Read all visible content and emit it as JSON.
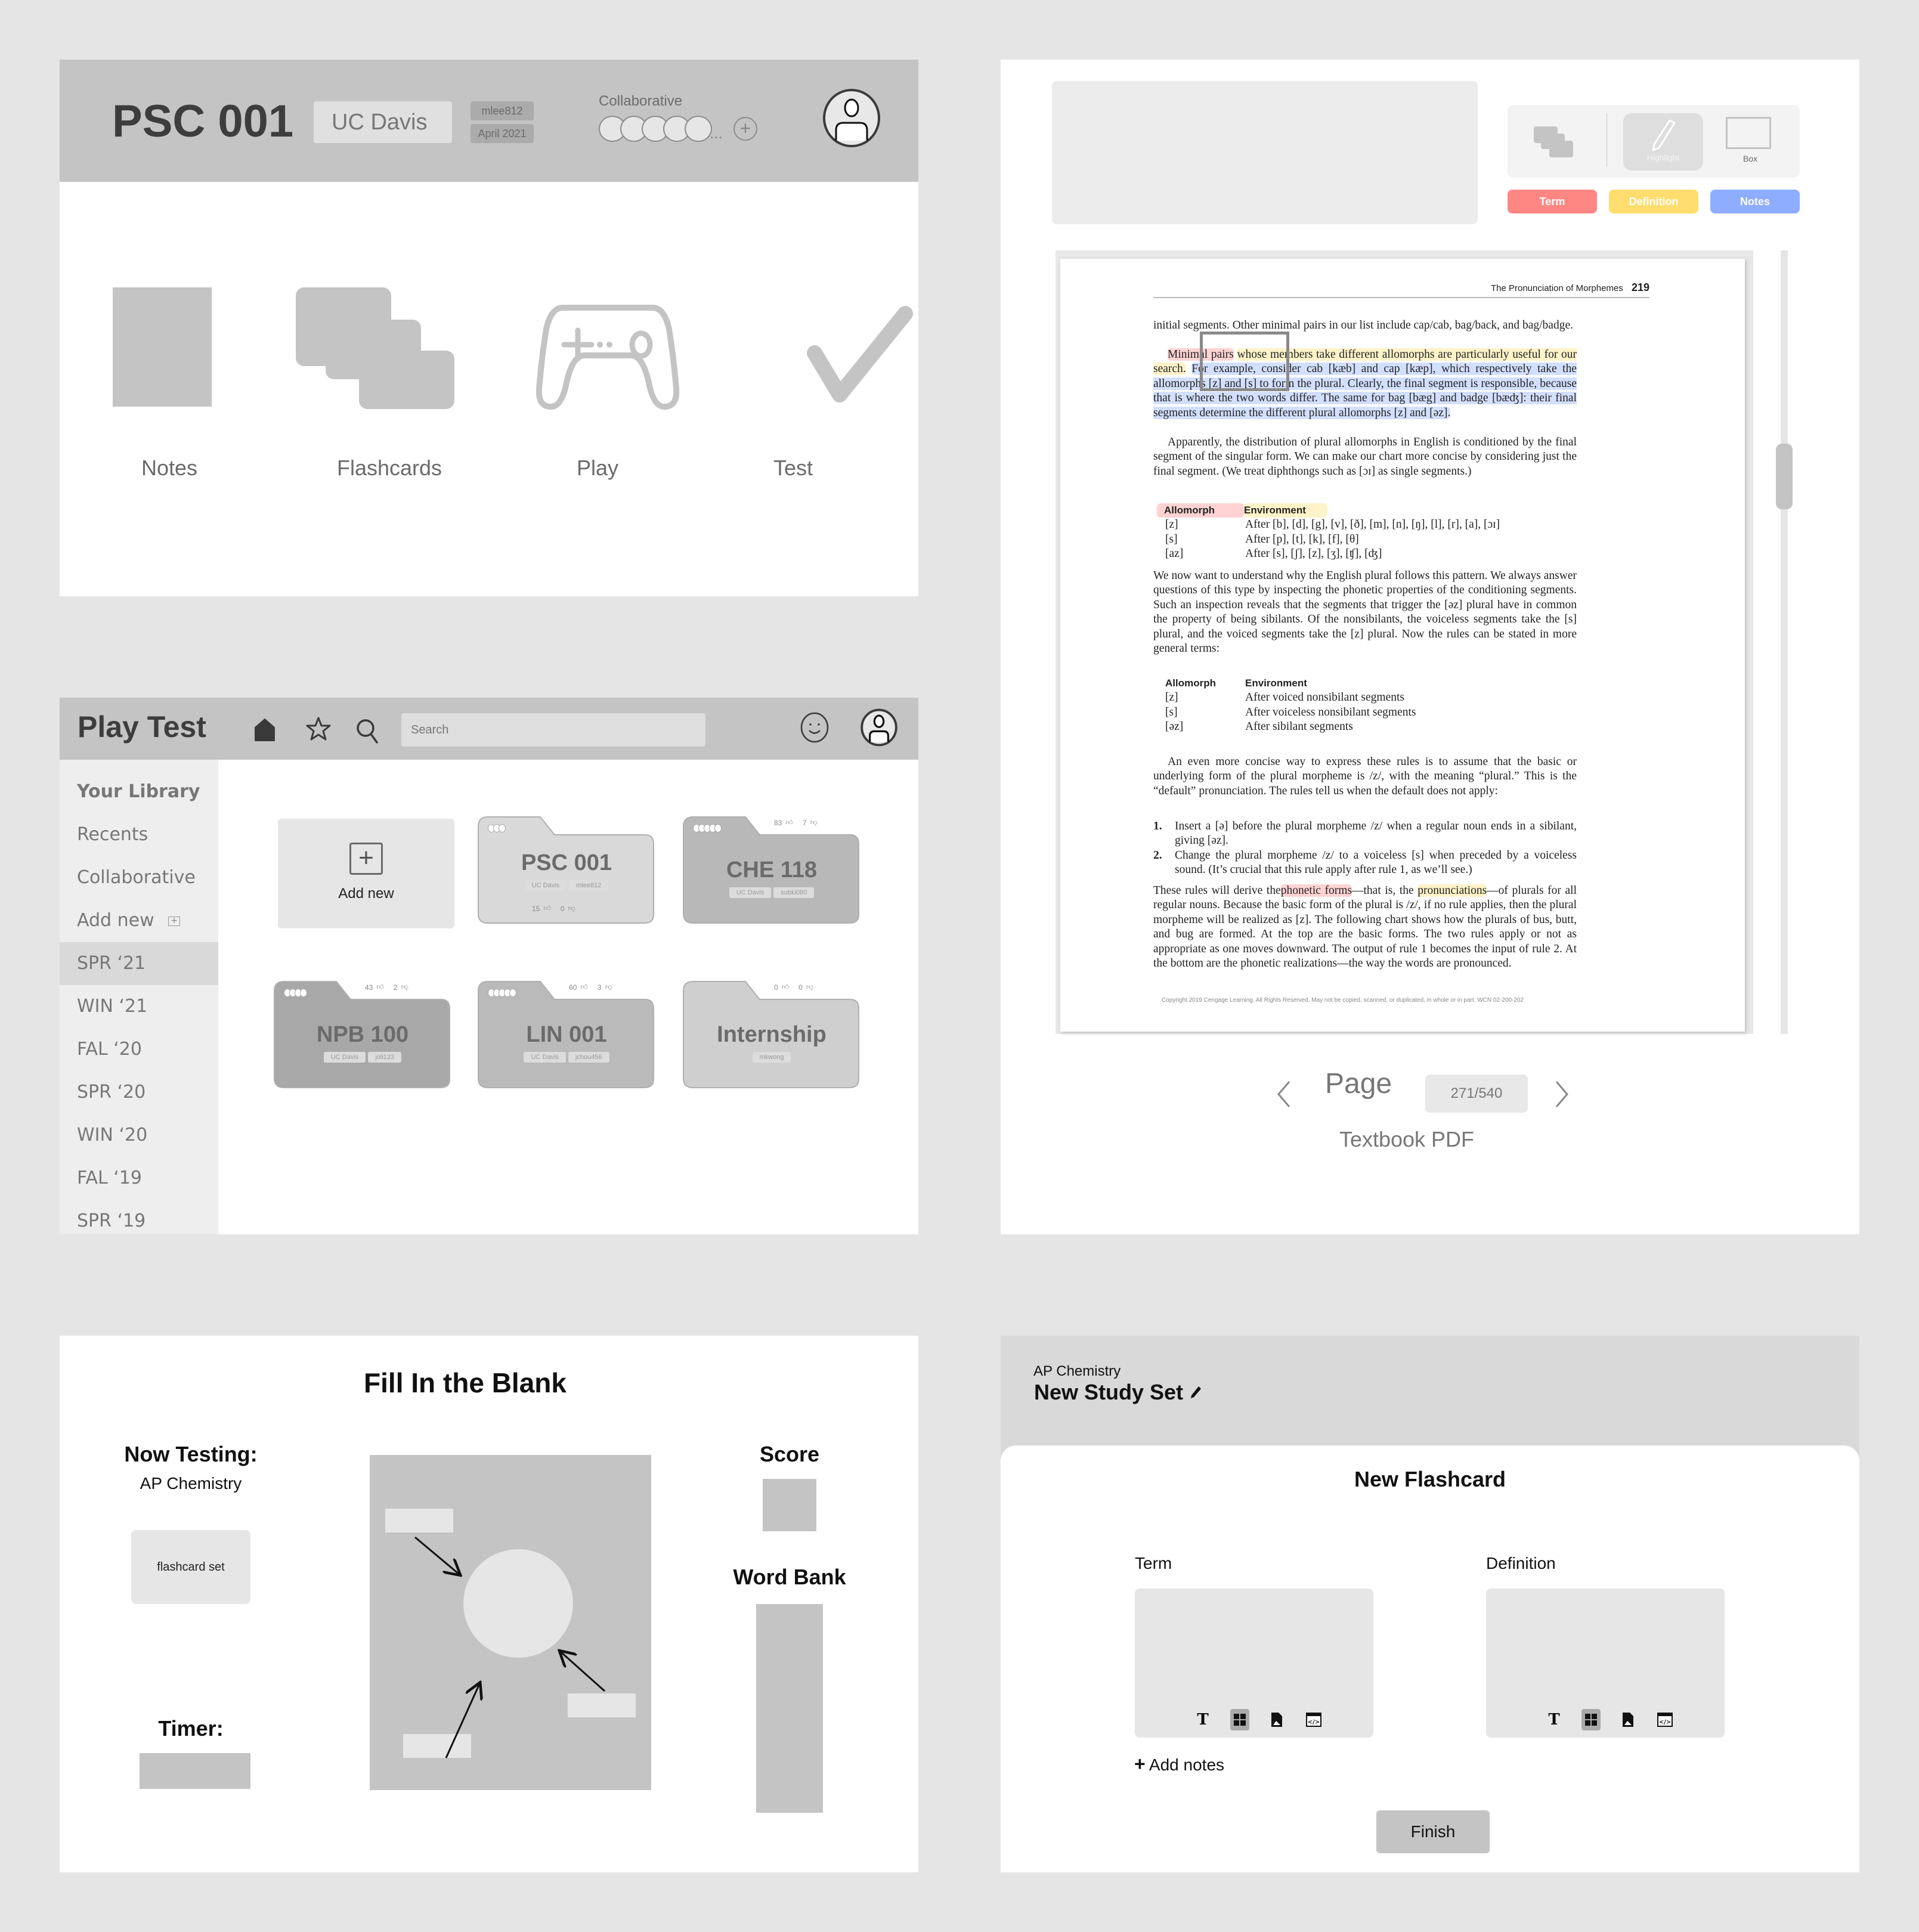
{
  "course_overview": {
    "title": "PSC 001",
    "school": "UC Davis",
    "owner": "mlee812",
    "term": "April 2021",
    "collaborative_label": "Collaborative",
    "collaborators_overflow": "...",
    "modes": [
      {
        "label": "Notes",
        "icon": "notes-icon"
      },
      {
        "label": "Flashcards",
        "icon": "flashcards-icon"
      },
      {
        "label": "Play",
        "icon": "gamepad-icon"
      },
      {
        "label": "Test",
        "icon": "checkmark-icon"
      }
    ]
  },
  "library": {
    "title": "Play Test",
    "search_placeholder": "Search",
    "sidebar": [
      {
        "label": "Your Library",
        "heading": true
      },
      {
        "label": "Recents"
      },
      {
        "label": "Collaborative"
      },
      {
        "label": "Add new",
        "icon": "plus-box-icon"
      },
      {
        "label": "SPR ‘21",
        "active": true
      },
      {
        "label": "WIN ‘21"
      },
      {
        "label": "FAL ‘20"
      },
      {
        "label": "SPR ‘20"
      },
      {
        "label": "WIN ‘20"
      },
      {
        "label": "FAL ‘19"
      },
      {
        "label": "SPR ‘19"
      }
    ],
    "add_new_label": "Add new",
    "folders": [
      {
        "title": "PSC 001",
        "tags": [
          "UC Davis",
          "mlee812"
        ],
        "likes": "15",
        "dislikes": "0",
        "collaborators": 3,
        "color": "#d9d9d9"
      },
      {
        "title": "CHE 118",
        "tags": [
          "UC Davis",
          "subki080"
        ],
        "likes": "83",
        "dislikes": "7",
        "collaborators": 5,
        "color": "#b8b8b8"
      },
      {
        "title": "NPB 100",
        "tags": [
          "UC Davis",
          "joli123"
        ],
        "likes": "43",
        "dislikes": "2",
        "collaborators": 4,
        "color": "#a8a8a8"
      },
      {
        "title": "LIN 001",
        "tags": [
          "UC Davis",
          "jchou456"
        ],
        "likes": "60",
        "dislikes": "3",
        "collaborators": 5,
        "color": "#bababa"
      },
      {
        "title": "Internship",
        "tags": [
          "mkwong"
        ],
        "likes": "0",
        "dislikes": "0",
        "collaborators": 0,
        "color": "#cfcfcf"
      }
    ]
  },
  "pdf_viewer": {
    "tools": {
      "highlight_label": "Highlight",
      "box_label": "Box"
    },
    "categories": [
      {
        "label": "Term",
        "color": "#ff8783"
      },
      {
        "label": "Definition",
        "color": "#ffdd6e"
      },
      {
        "label": "Notes",
        "color": "#8eadff"
      }
    ],
    "page_header": "The Pronunciation of Morphemes",
    "page_number": "219",
    "para1": "initial segments. Other minimal pairs in our list include cap/cab, bag/back, and bag/badge.",
    "para2_term": "Minimal pairs",
    "para2_def": "whose members take different allomorphs are particularly useful for our search.",
    "para2_note": "For example, consider cab [kæb] and cap [kæp], which respectively take the allomorphs [z] and [s] to form the plural. Clearly, the final segment is responsible, because that is where the two words differ. The same for bag [bæg] and badge [bæʤ]: their final segments determine the different plural allomorphs [z] and [əz].",
    "para3": "Apparently, the distribution of plural allomorphs in English is conditioned by the final segment of the singular form. We can make our chart more concise by considering just the final segment. (We treat diphthongs such as [ɔɪ] as single segments.)",
    "table1": {
      "headers": [
        "Allomorph",
        "Environment"
      ],
      "rows": [
        [
          "[z]",
          "After [b], [d], [g], [v], [ð], [m], [n], [ŋ], [l], [r], [a], [ɔɪ]"
        ],
        [
          "[s]",
          "After [p], [t], [k], [f], [θ]"
        ],
        [
          "[az]",
          "After [s], [ʃ], [z], [ʒ], [ʧ], [ʤ]"
        ]
      ]
    },
    "para4": "We now want to understand why the English plural follows this pattern. We always answer questions of this type by inspecting the phonetic properties of the conditioning segments. Such an inspection reveals that the segments that trigger the [əz] plural have in common the property of being sibilants. Of the nonsibilants, the voiceless segments take the [s] plural, and the voiced segments take the [z] plural. Now the rules can be stated in more general terms:",
    "table2": {
      "headers": [
        "Allomorph",
        "Environment"
      ],
      "rows": [
        [
          "[z]",
          "After voiced nonsibilant segments"
        ],
        [
          "[s]",
          "After voiceless nonsibilant segments"
        ],
        [
          "[əz]",
          "After sibilant segments"
        ]
      ]
    },
    "para5": "An even more concise way to express these rules is to assume that the basic or underlying form of the plural morpheme is /z/, with the meaning “plural.” This is the “default” pronunciation. The rules tell us when the default does not apply:",
    "rules": [
      {
        "num": "1.",
        "text": "Insert a [ə] before the plural morpheme /z/ when a regular noun ends in a sibilant, giving [əz]."
      },
      {
        "num": "2.",
        "text": "Change the plural morpheme /z/ to a voiceless [s] when preceded by a voiceless sound. (It’s crucial that this rule apply after rule 1, as we’ll see.)"
      }
    ],
    "para6_a": "These rules will derive the",
    "para6_term": "phonetic forms",
    "para6_b": "—that is, the",
    "para6_def": "pronunciations",
    "para6_c": "—of plurals for all regular nouns. Because the basic form of the plural is /z/, if no rule applies, then the plural morpheme will be realized as [z]. The following chart shows how the plurals of bus, butt, and bug are formed. At the top are the basic forms. The two rules apply or not as appropriate as one moves downward. The output of rule 1 becomes the input of rule 2. At the bottom are the phonetic realizations—the way the words are pronounced.",
    "copyright": "Copyright 2019 Cengage Learning. All Rights Reserved. May not be copied, scanned, or duplicated, in whole or in part.  WCN 02-200-202",
    "page_label": "Page",
    "page_value": "271/540",
    "caption": "Textbook PDF"
  },
  "fill_blank": {
    "title": "Fill In the Blank",
    "now_testing_label": "Now Testing:",
    "now_testing_value": "AP Chemistry",
    "set_card": "flashcard set",
    "timer_label": "Timer:",
    "score_label": "Score",
    "word_bank_label": "Word Bank"
  },
  "new_flashcard": {
    "course": "AP Chemistry",
    "set_title": "New Study Set",
    "heading": "New Flashcard",
    "term_label": "Term",
    "definition_label": "Definition",
    "add_notes": "Add notes",
    "finish": "Finish",
    "format_tools": [
      "text-icon",
      "grid-icon",
      "image-file-icon",
      "code-icon"
    ]
  }
}
